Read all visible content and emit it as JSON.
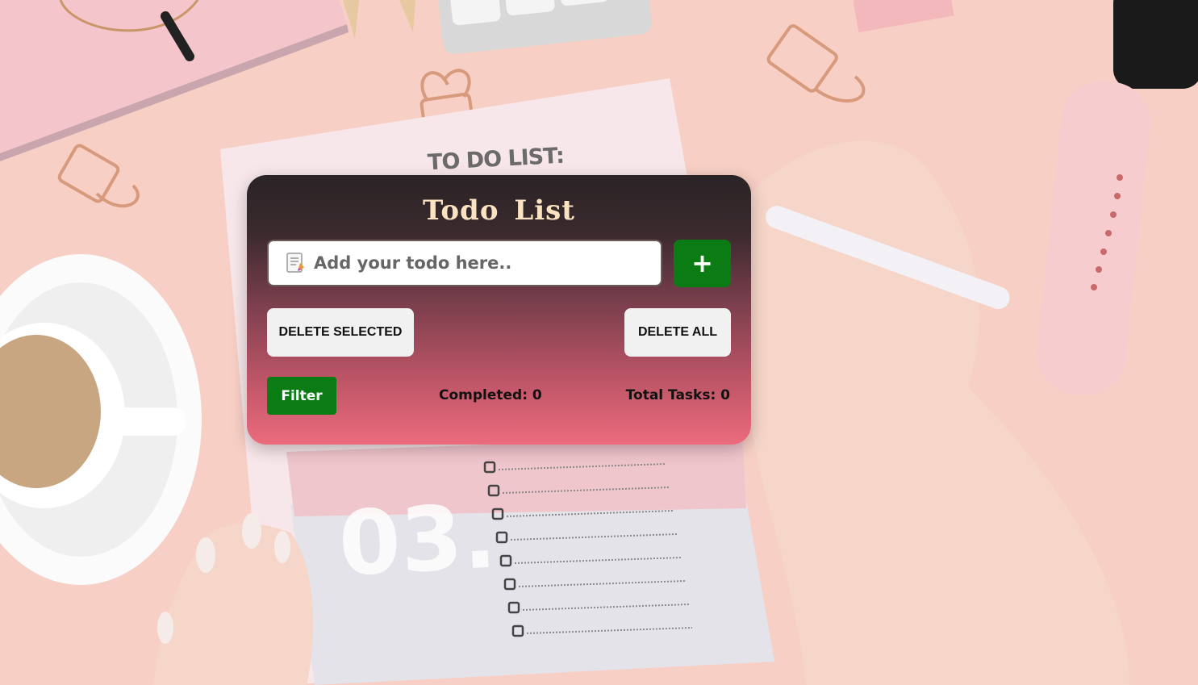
{
  "background": {
    "notepad_heading": "TO DO LIST:",
    "notepad_number": "03.",
    "accent_color": "#f7cfc4"
  },
  "app": {
    "title": "Todo List",
    "input": {
      "placeholder": "Add your todo here..",
      "value": "",
      "icon": "memo-icon"
    },
    "add_button_label": "+",
    "delete_selected_label": "DELETE SELECTED",
    "delete_all_label": "DELETE ALL",
    "filter_label": "Filter",
    "completed_label": "Completed: 0",
    "total_label": "Total Tasks: 0",
    "colors": {
      "title": "#fbe3c2",
      "primary_button": "#0a7c13",
      "secondary_button": "#f1f1f1",
      "gradient_top": "#2a2325",
      "gradient_bottom": "#ec6b7c"
    }
  }
}
